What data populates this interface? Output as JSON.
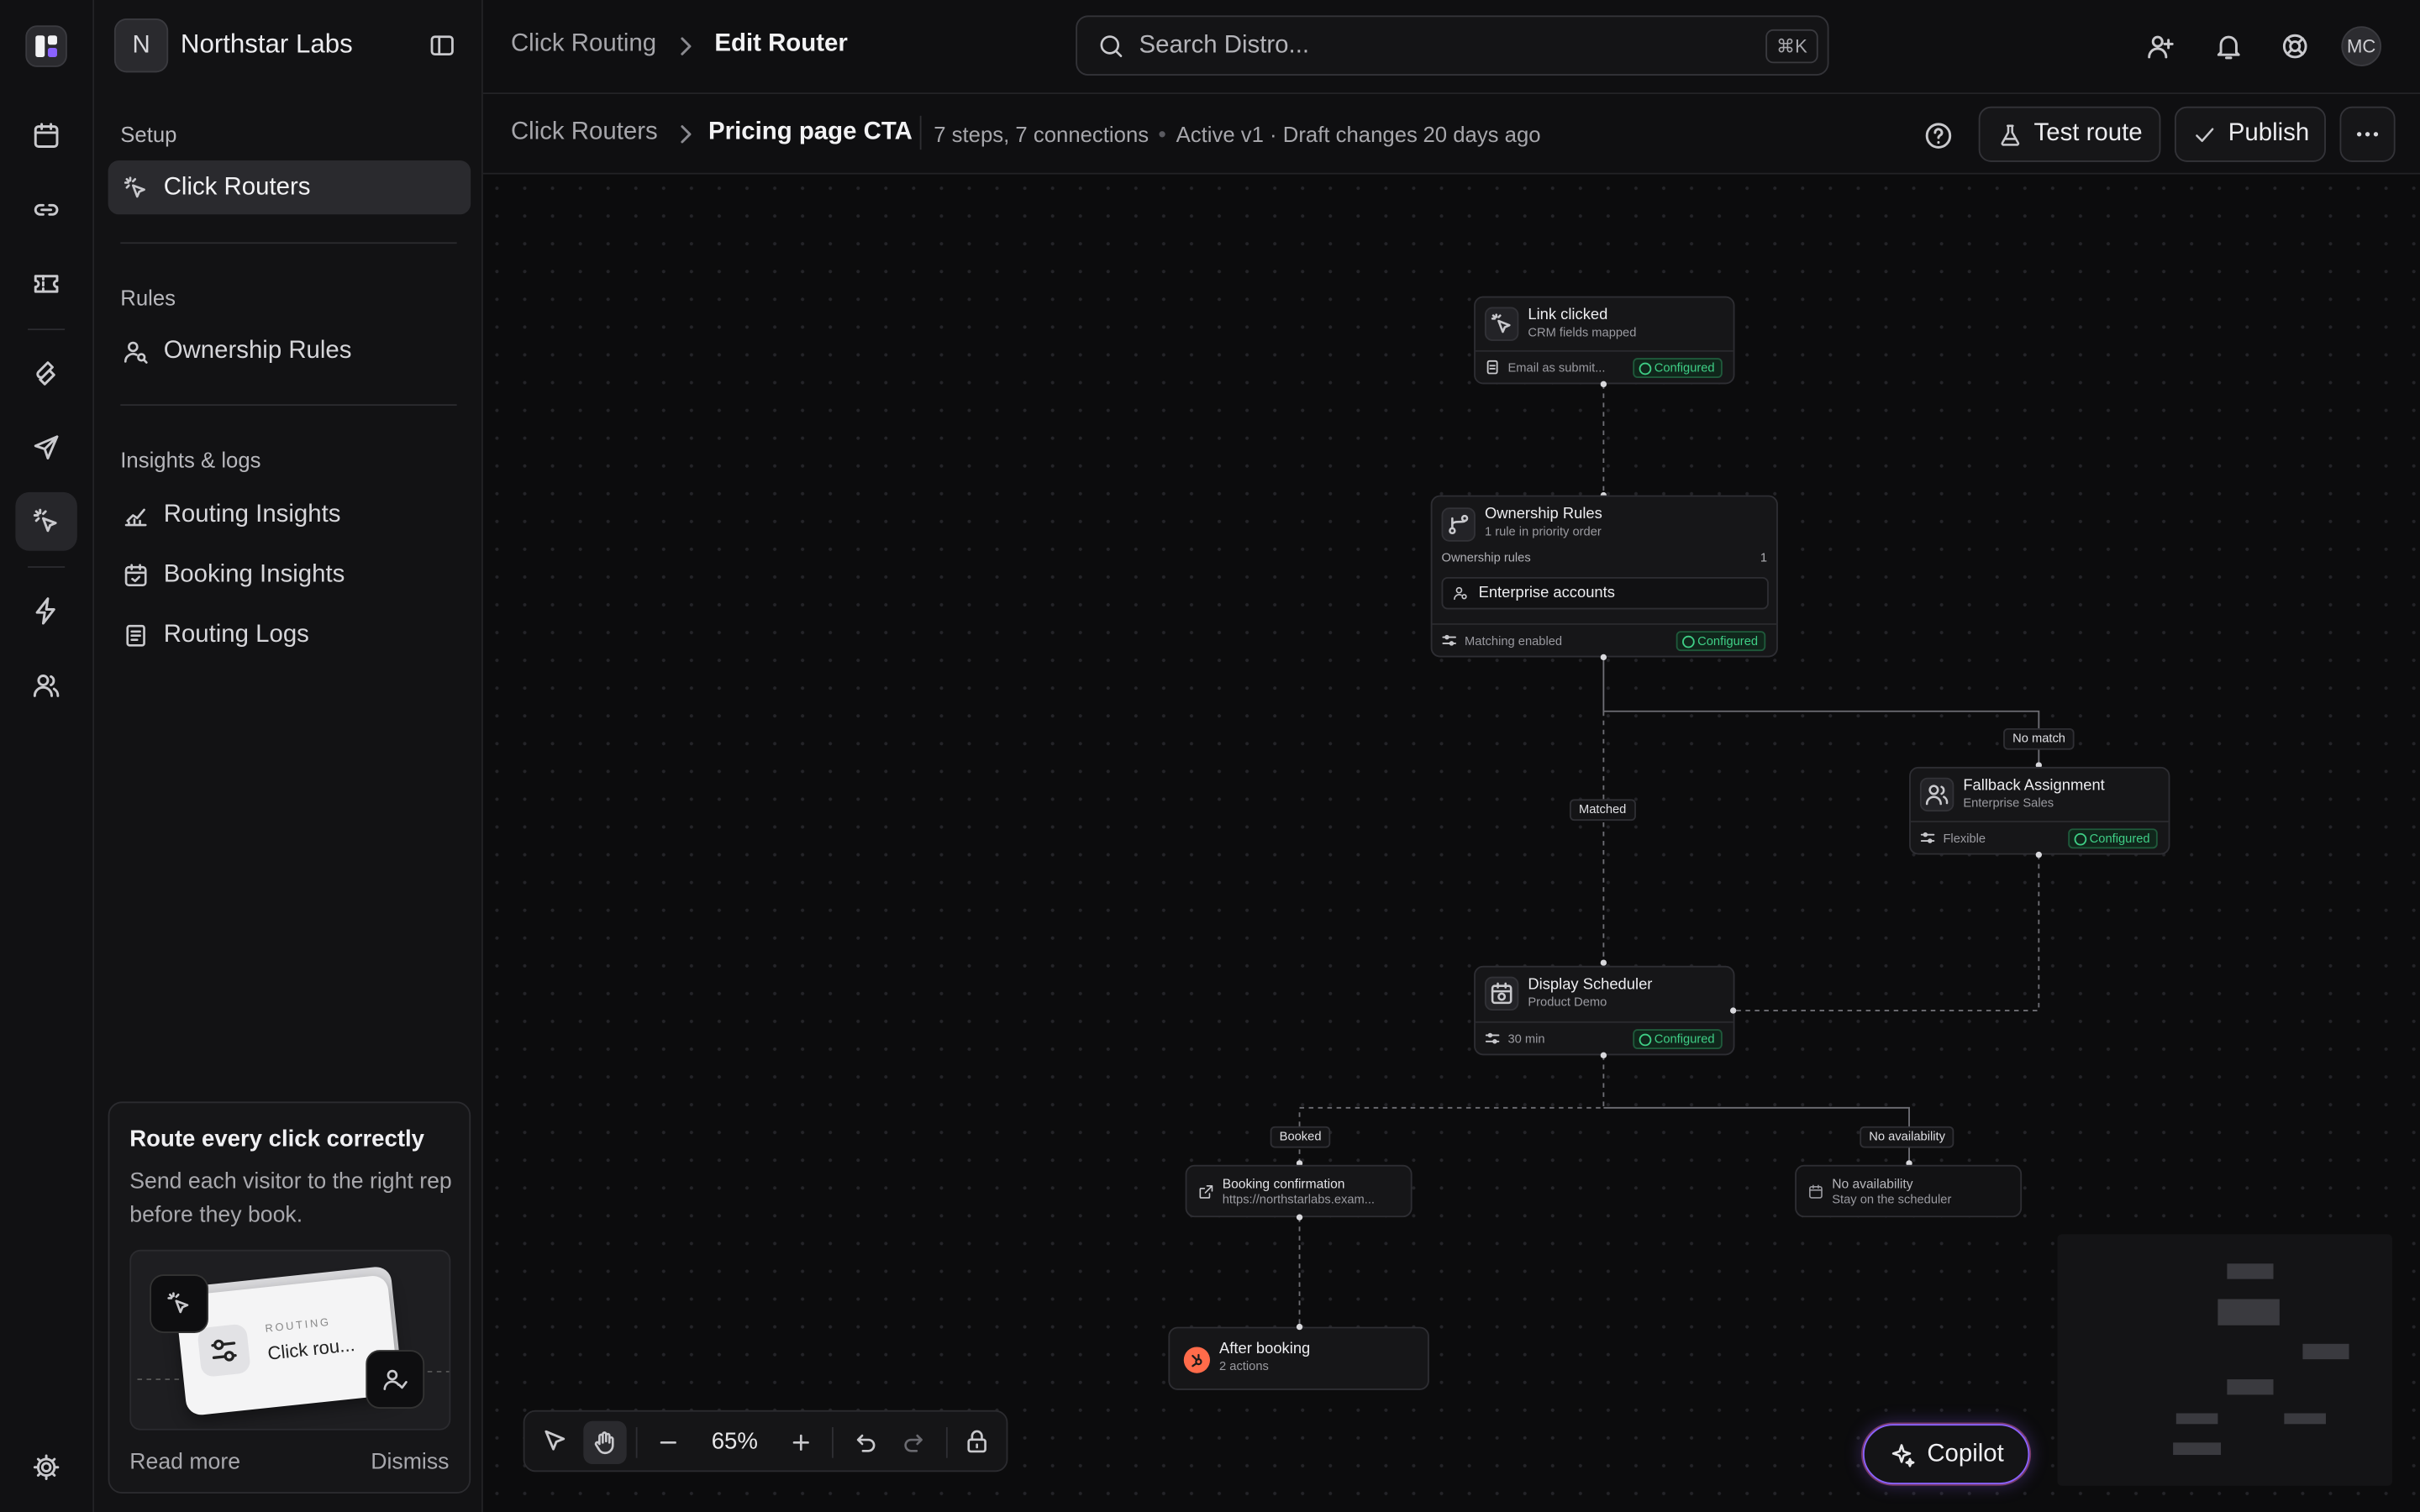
{
  "app": {
    "workspace_initial": "N",
    "workspace_name": "Northstar Labs",
    "user_initials": "MC"
  },
  "sidebar": {
    "sections": [
      {
        "label": "Setup"
      },
      {
        "label": "Rules"
      },
      {
        "label": "Insights & logs"
      }
    ],
    "items": [
      {
        "label": "Click Routers",
        "icon": "cursor-click-icon",
        "active": true
      },
      {
        "label": "Ownership Rules",
        "icon": "user-search-icon"
      },
      {
        "label": "Routing Insights",
        "icon": "chart-icon"
      },
      {
        "label": "Booking Insights",
        "icon": "calendar-check-icon"
      },
      {
        "label": "Routing Logs",
        "icon": "log-list-icon"
      }
    ],
    "promo": {
      "title": "Route every click correctly",
      "body": "Send each visitor to the right rep before they book.",
      "card_kicker": "ROUTING",
      "card_title": "Click rou...",
      "read_more": "Read more",
      "dismiss": "Dismiss"
    }
  },
  "header": {
    "breadcrumb_root": "Click Routing",
    "breadcrumb_current": "Edit Router",
    "search_placeholder": "Search Distro...",
    "search_shortcut": "⌘K"
  },
  "subheader": {
    "crumb_root": "Click Routers",
    "crumb_current": "Pricing page CTA",
    "meta_steps": "7 steps, 7 connections",
    "meta_status": "Active v1 · Draft changes",
    "meta_time": "20 days ago",
    "test_label": "Test route",
    "publish_label": "Publish"
  },
  "flow": {
    "trigger": {
      "title": "Link clicked",
      "subtitle": "CRM fields mapped",
      "foot": "Email as submit...",
      "badge": "Configured"
    },
    "ownership": {
      "title": "Ownership Rules",
      "subtitle": "1 rule in priority order",
      "section": "Ownership rules",
      "count": "1",
      "rule": "Enterprise accounts",
      "foot": "Matching enabled",
      "badge": "Configured"
    },
    "fallback": {
      "title": "Fallback Assignment",
      "subtitle": "Enterprise Sales",
      "foot": "Flexible",
      "badge": "Configured"
    },
    "scheduler": {
      "title": "Display Scheduler",
      "subtitle": "Product Demo",
      "foot": "30 min",
      "badge": "Configured"
    },
    "booking": {
      "title": "Booking confirmation",
      "subtitle": "https://northstarlabs.exam..."
    },
    "noavail": {
      "title": "No availability",
      "subtitle": "Stay on the scheduler"
    },
    "after": {
      "title": "After booking",
      "subtitle": "2 actions"
    },
    "edges": {
      "no_match": "No match",
      "matched": "Matched",
      "booked": "Booked",
      "no_availability": "No availability"
    }
  },
  "canvas_controls": {
    "zoom": "65%",
    "copilot": "Copilot"
  },
  "colors": {
    "accent": "#8a62ff",
    "success": "#3fcf86",
    "after_booking": "#ff6b4a"
  }
}
